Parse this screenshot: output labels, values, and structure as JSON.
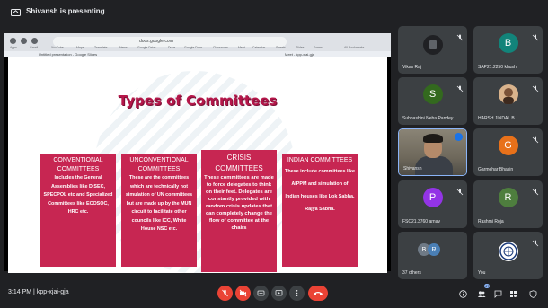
{
  "presenting_banner": "Shivansh is presenting",
  "browser": {
    "address": "docs.google.com",
    "bookmarks": [
      "Apps",
      "Gmail",
      "YouTube",
      "Maps",
      "Translate",
      "News",
      "Google Drive",
      "Drive",
      "Google Docs",
      "Classroom",
      "Meet",
      "Calendar",
      "Sheets",
      "Slides",
      "Forms",
      "All Bookmarks"
    ],
    "tabs": [
      "Untitled presentation - Google Slides",
      "Meet - kpp-xjai-gja"
    ]
  },
  "slide": {
    "title": "Types of Committees",
    "boxes": [
      {
        "heading": "CONVENTIONAL COMMITTEES",
        "body": "Includes the General Assemblies like DISEC, SPECPOL etc and Specialized Committees like ECOSOC, HRC etc."
      },
      {
        "heading": "UNCONVENTIONAL COMMITTEES",
        "body": "These are the committees which are technically not simulation of UN committees but are made up by the MUN circuit to facilitate other councils like ICC, White House NSC etc."
      },
      {
        "heading": "CRISIS COMMITTEES",
        "body": "These committees are made to force delegates to think on their feet. Delegates are constantly provided with random crisis updates that can completely change the flow of committee at the chairs"
      },
      {
        "heading": "INDIAN COMMITTEES",
        "body": "These include committees like AIPPM and simulation of Indian houses like Lok Sabha, Rajya Sabha."
      }
    ]
  },
  "participants": [
    {
      "name": "Vikas Raj",
      "initial": "",
      "color": "#3c4043",
      "type": "blank"
    },
    {
      "name": "SAP21.2250 khushi",
      "initial": "B",
      "color": "#12847a",
      "type": "avatar"
    },
    {
      "name": "Subhashini Neha Pandey",
      "initial": "S",
      "color": "#33691e",
      "type": "avatar"
    },
    {
      "name": "HARSH JINDAL B",
      "initial": "",
      "color": "#5d4037",
      "type": "photo"
    },
    {
      "name": "Shivansh",
      "initial": "",
      "color": "#6e685b",
      "type": "camera"
    },
    {
      "name": "Garmehar Bhasin",
      "initial": "G",
      "color": "#e8711a",
      "type": "avatar"
    },
    {
      "name": "FSC21.3760 arnav",
      "initial": "P",
      "color": "#9334e6",
      "type": "avatar"
    },
    {
      "name": "Rashmi Roja",
      "initial": "R",
      "color": "#4e7e3e",
      "type": "avatar"
    },
    {
      "name": "37 others",
      "initial": "B R",
      "color": "#3c4043",
      "type": "group"
    },
    {
      "name": "You",
      "initial": "",
      "color": "#3c4043",
      "type": "self"
    }
  ],
  "bottom": {
    "time": "3:14 PM",
    "separator": "|",
    "meeting_code": "kpp-xjai-gja",
    "people_count": "47"
  },
  "colors": {
    "accent_red": "#ea4335",
    "slide_box": "#c72652",
    "title": "#b5174a",
    "bg": "#202124"
  }
}
